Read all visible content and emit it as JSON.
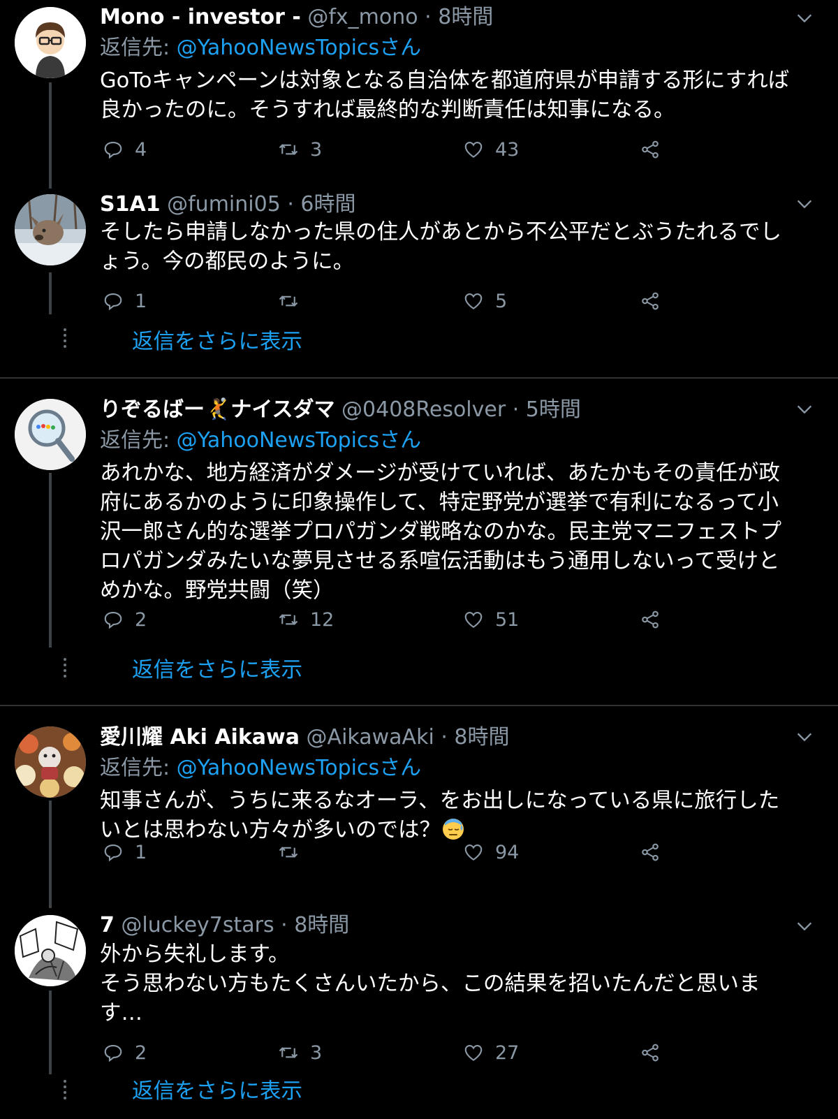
{
  "reply_prefix": "返信先: ",
  "more_replies_label": "返信をさらに表示",
  "tweets": [
    {
      "name": "Mono - investor -",
      "handle": "@fx_mono",
      "sep": " · ",
      "time": "8時間",
      "reply_to": "@YahooNewsTopicsさん",
      "text": "GoToキャンペーンは対象となる自治体を都道府県が申請する形にすれば良かったのに。そうすれば最終的な判断責任は知事になる。",
      "replies": "4",
      "retweets": "3",
      "likes": "43"
    },
    {
      "name": "S1A1",
      "handle": "@fumini05",
      "sep": " · ",
      "time": "6時間",
      "text": "そしたら申請しなかった県の住人があとから不公平だとぶうたれるでしょう。今の都民のように。",
      "replies": "1",
      "retweets": "",
      "likes": "5"
    },
    {
      "name": "りぞるばー🤾ナイスダマ",
      "handle": "@0408Resolver",
      "sep": " · ",
      "time": "5時間",
      "reply_to": "@YahooNewsTopicsさん",
      "text": "あれかな、地方経済がダメージが受けていれば、あたかもその責任が政府にあるかのように印象操作して、特定野党が選挙で有利になるって小沢一郎さん的な選挙プロパガンダ戦略なのかな。民主党マニフェストプロパガンダみたいな夢見させる系喧伝活動はもう通用しないって受けとめかな。野党共闘（笑）",
      "replies": "2",
      "retweets": "12",
      "likes": "51"
    },
    {
      "name": "愛川耀 Aki Aikawa",
      "handle": "@AikawaAki",
      "sep": " · ",
      "time": "8時間",
      "reply_to": "@YahooNewsTopicsさん",
      "text": "知事さんが、うちに来るなオーラ、をお出しになっている県に旅行したいとは思わない方々が多いのでは？",
      "replies": "1",
      "retweets": "",
      "likes": "94"
    },
    {
      "name": "7",
      "handle": "@luckey7stars",
      "sep": " · ",
      "time": "8時間",
      "text": "外から失礼します。\nそう思わない方もたくさんいたから、この結果を招いたんだと思います…",
      "replies": "2",
      "retweets": "3",
      "likes": "27"
    }
  ],
  "colors": {
    "background": "#000000",
    "text": "#ffffff",
    "secondary": "#8b98a5",
    "accent": "#1da1f2",
    "divider": "#2f3336"
  },
  "icons": [
    "reply-icon",
    "retweet-icon",
    "like-icon",
    "share-icon",
    "chevron-down-icon"
  ]
}
